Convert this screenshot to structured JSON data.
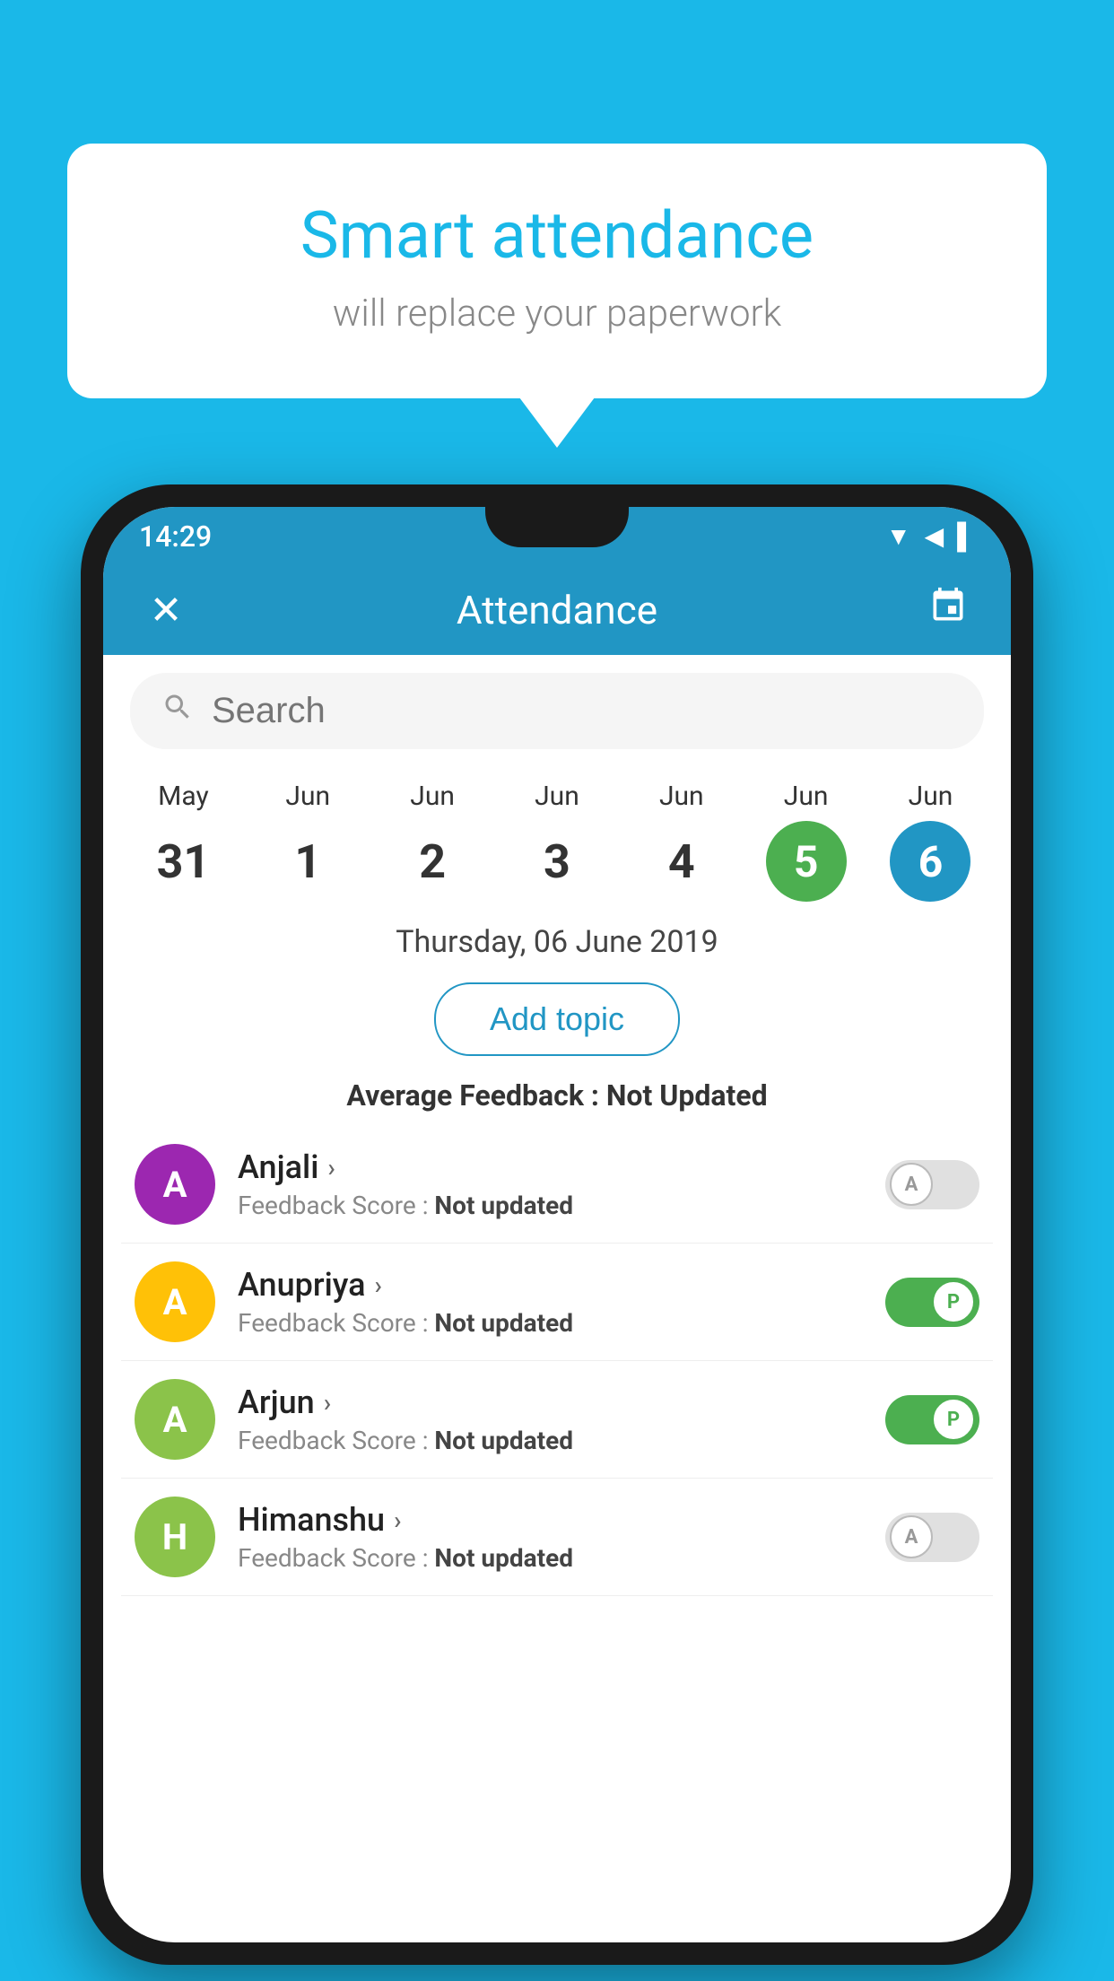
{
  "background": {
    "color": "#1ab8e8"
  },
  "speech_bubble": {
    "title": "Smart attendance",
    "subtitle": "will replace your paperwork"
  },
  "status_bar": {
    "time": "14:29",
    "wifi": "▲",
    "signal": "▲",
    "battery": "▌"
  },
  "app_bar": {
    "title": "Attendance",
    "close_label": "×",
    "calendar_label": "📅"
  },
  "search": {
    "placeholder": "Search"
  },
  "calendar": {
    "days": [
      {
        "month": "May",
        "num": "31",
        "state": "normal"
      },
      {
        "month": "Jun",
        "num": "1",
        "state": "normal"
      },
      {
        "month": "Jun",
        "num": "2",
        "state": "normal"
      },
      {
        "month": "Jun",
        "num": "3",
        "state": "normal"
      },
      {
        "month": "Jun",
        "num": "4",
        "state": "normal"
      },
      {
        "month": "Jun",
        "num": "5",
        "state": "today"
      },
      {
        "month": "Jun",
        "num": "6",
        "state": "selected"
      }
    ],
    "selected_date_label": "Thursday, 06 June 2019"
  },
  "add_topic_label": "Add topic",
  "avg_feedback": {
    "label": "Average Feedback : ",
    "value": "Not Updated"
  },
  "students": [
    {
      "name": "Anjali",
      "avatar_letter": "A",
      "avatar_color": "#9c27b0",
      "feedback_label": "Feedback Score : ",
      "feedback_value": "Not updated",
      "toggle_state": "absent",
      "toggle_label": "A"
    },
    {
      "name": "Anupriya",
      "avatar_letter": "A",
      "avatar_color": "#ffc107",
      "feedback_label": "Feedback Score : ",
      "feedback_value": "Not updated",
      "toggle_state": "present",
      "toggle_label": "P"
    },
    {
      "name": "Arjun",
      "avatar_letter": "A",
      "avatar_color": "#8bc34a",
      "feedback_label": "Feedback Score : ",
      "feedback_value": "Not updated",
      "toggle_state": "present",
      "toggle_label": "P"
    },
    {
      "name": "Himanshu",
      "avatar_letter": "H",
      "avatar_color": "#8bc34a",
      "feedback_label": "Feedback Score : ",
      "feedback_value": "Not updated",
      "toggle_state": "absent",
      "toggle_label": "A"
    }
  ]
}
